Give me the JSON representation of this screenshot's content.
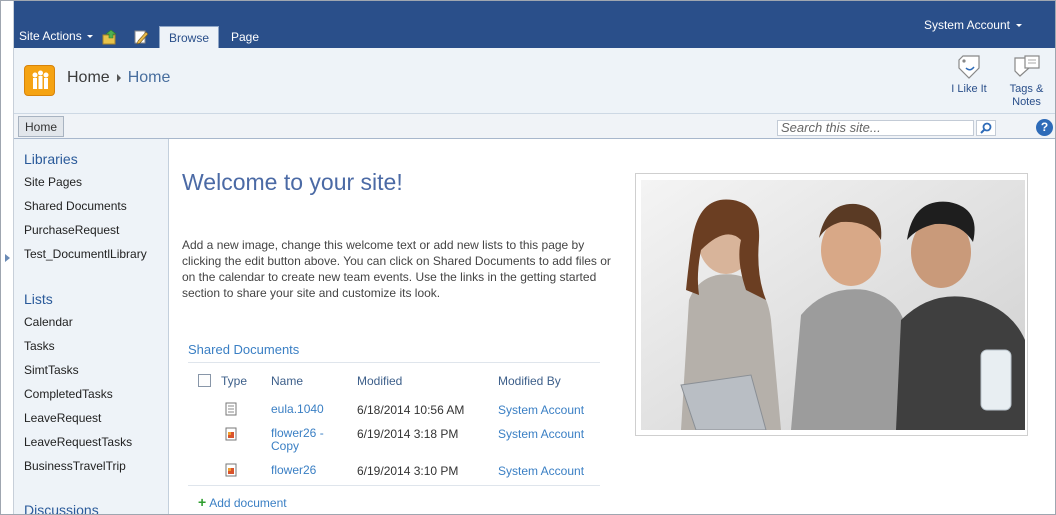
{
  "ribbon": {
    "site_actions": "Site Actions",
    "tabs": [
      {
        "label": "Browse"
      },
      {
        "label": "Page"
      }
    ],
    "user": "System Account"
  },
  "title_area": {
    "breadcrumb_root": "Home",
    "breadcrumb_current": "Home",
    "actions": [
      {
        "label": "I Like It"
      },
      {
        "label": "Tags &"
      },
      {
        "label": "Notes"
      }
    ]
  },
  "topnav": {
    "home": "Home",
    "search_placeholder": "Search this site..."
  },
  "quicklaunch": {
    "libraries_heading": "Libraries",
    "libraries": [
      "Site Pages",
      "Shared Documents",
      "PurchaseRequest",
      "Test_DocumentlLibrary"
    ],
    "lists_heading": "Lists",
    "lists": [
      "Calendar",
      "Tasks",
      "SimtTasks",
      "CompletedTasks",
      "LeaveRequest",
      "LeaveRequestTasks",
      "BusinessTravelTrip"
    ],
    "discussions_heading": "Discussions"
  },
  "content": {
    "welcome_title": "Welcome to your site!",
    "welcome_text": "Add a new image, change this welcome text or add new lists to this page by clicking the edit button above. You can click on Shared Documents to add files or on the calendar to create new team events. Use the links in the getting started section to share your site and customize its look.",
    "shared_docs": {
      "title": "Shared Documents",
      "columns": [
        "Type",
        "Name",
        "Modified",
        "Modified By"
      ],
      "rows": [
        {
          "type": "text-file-icon",
          "name": "eula.1040",
          "modified": "6/18/2014 10:56 AM",
          "modified_by": "System Account"
        },
        {
          "type": "image-file-icon",
          "name_line1": "flower26 -",
          "name_line2": "Copy",
          "modified": "6/19/2014 3:18 PM",
          "modified_by": "System Account"
        },
        {
          "type": "image-file-icon",
          "name": "flower26",
          "modified": "6/19/2014 3:10 PM",
          "modified_by": "System Account"
        }
      ],
      "add_document": "Add document"
    }
  },
  "colors": {
    "ribbon_blue": "#2a4f8a",
    "link_blue": "#3a7fc4",
    "title_blue": "#4b6aa5",
    "panel_bg": "#eef3f8",
    "logo_orange": "#f5a313"
  }
}
